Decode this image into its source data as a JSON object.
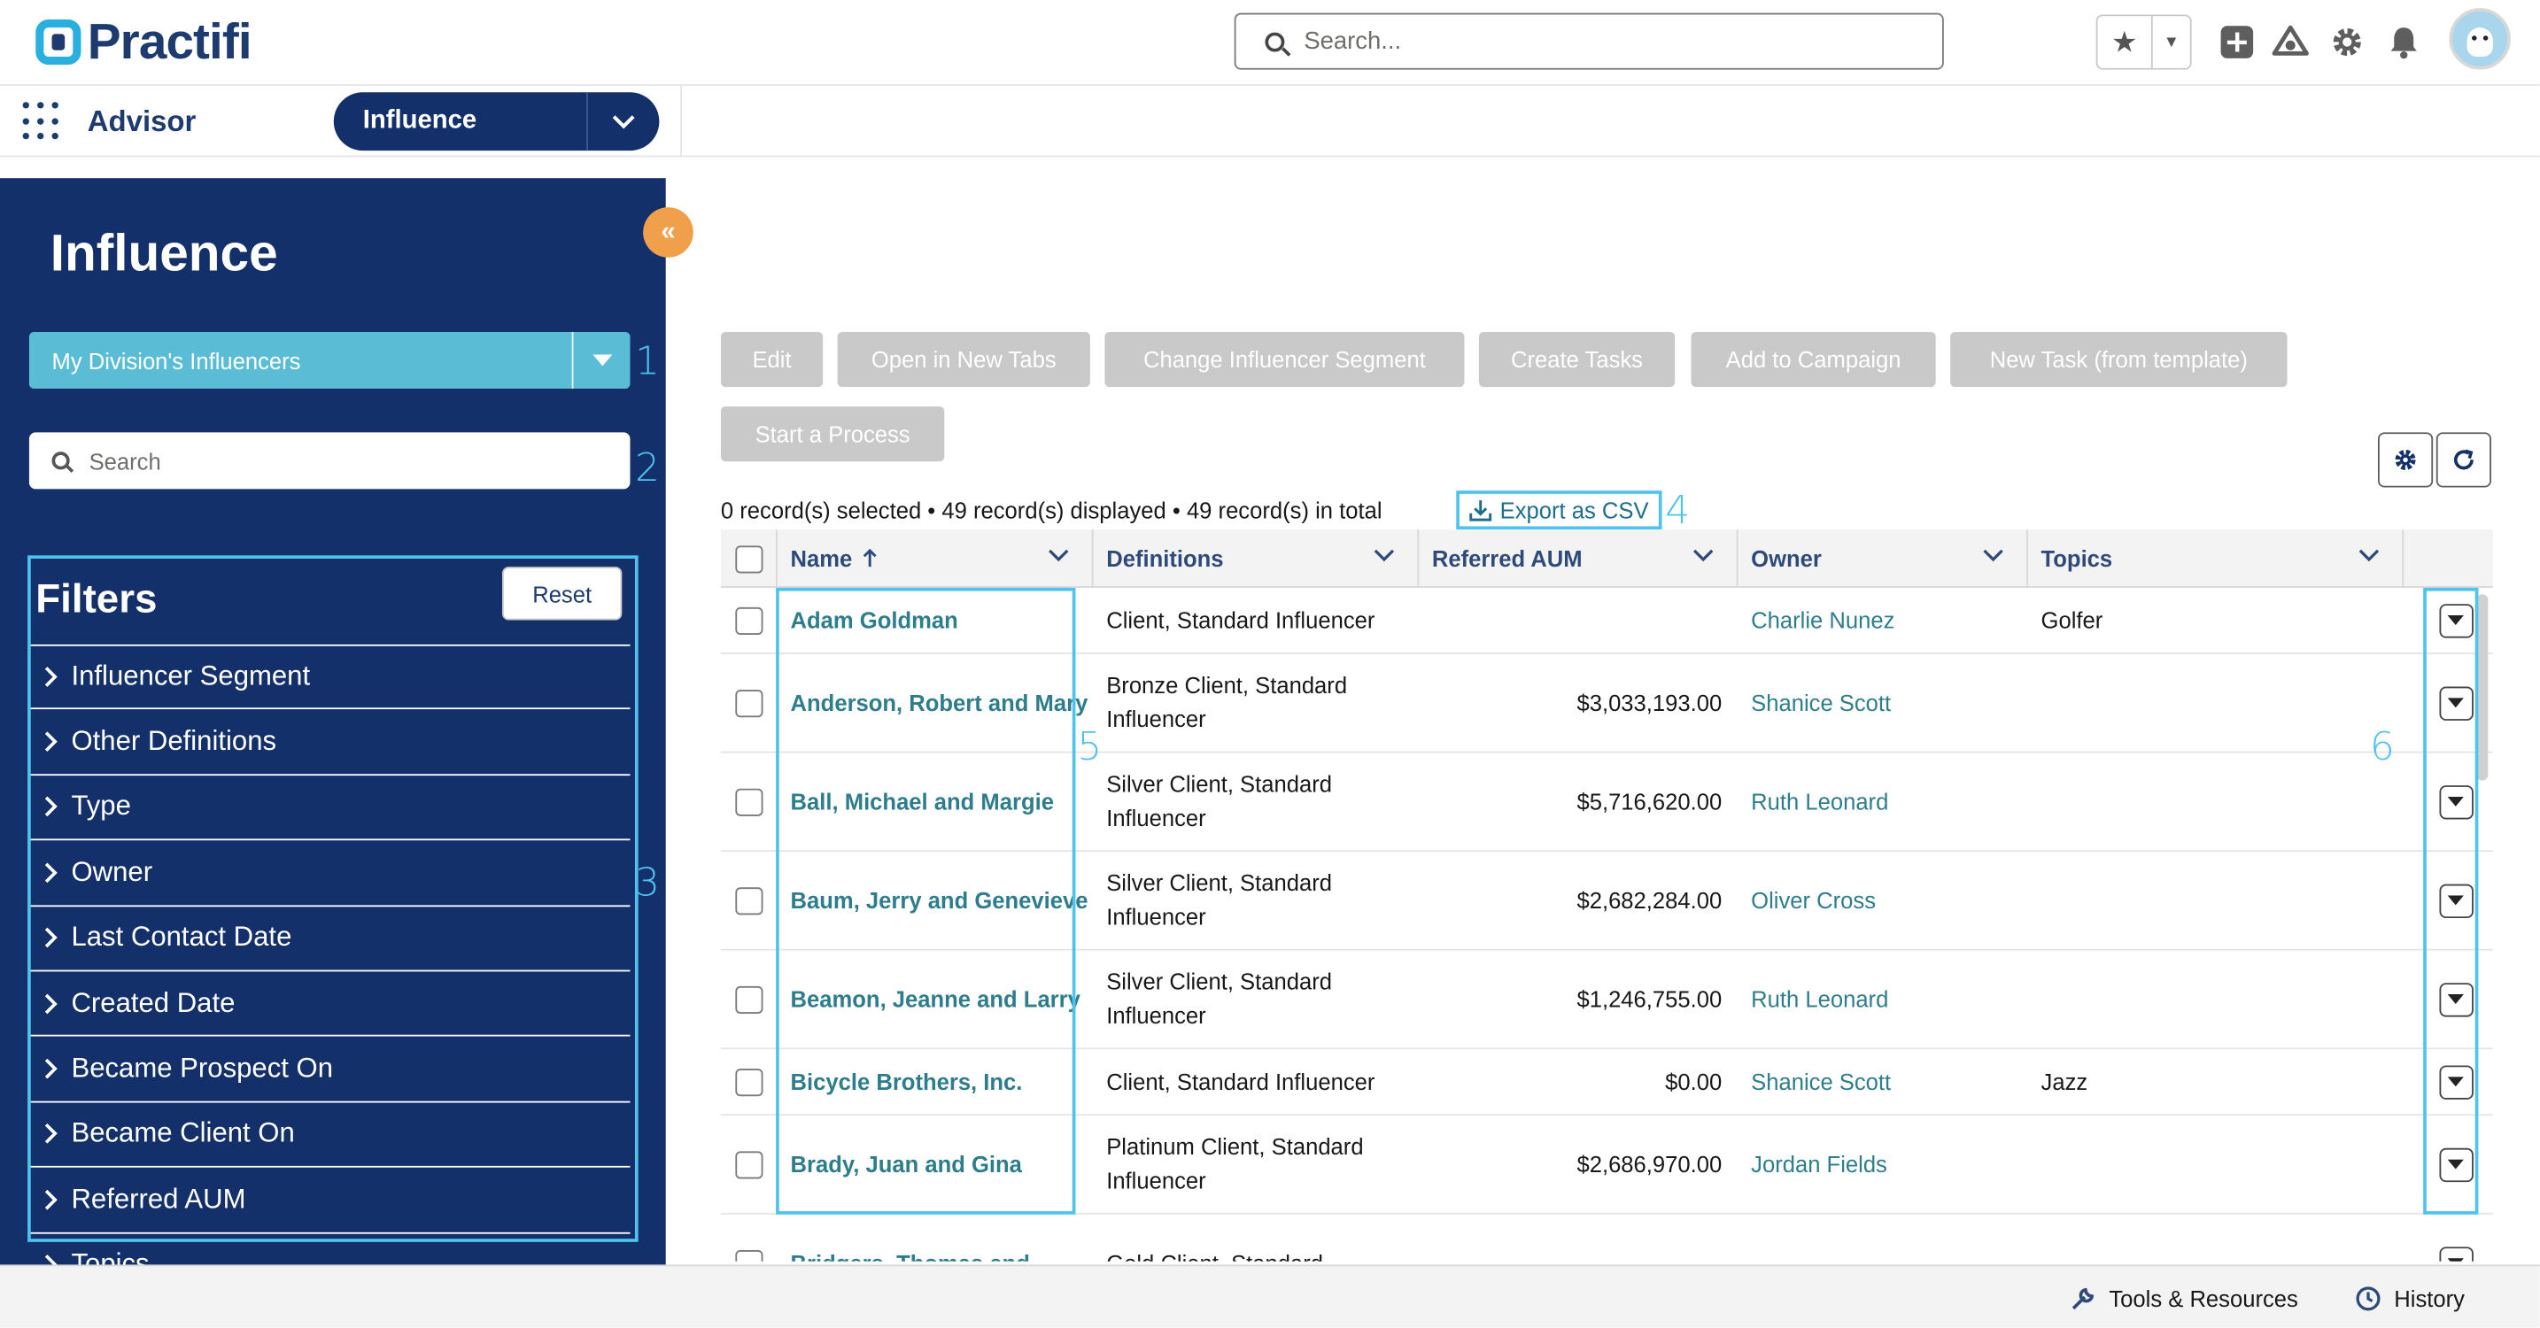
{
  "brand": {
    "name": "Practifi"
  },
  "header": {
    "search_placeholder": "Search...",
    "favorites_icon": "star-icon"
  },
  "appbar": {
    "app_name": "Advisor",
    "tab_label": "Influence"
  },
  "sidebar": {
    "title": "Influence",
    "list_view": "My Division's Influencers",
    "search_placeholder": "Search",
    "filters_title": "Filters",
    "reset_label": "Reset",
    "filters": [
      "Influencer Segment",
      "Other Definitions",
      "Type",
      "Owner",
      "Last Contact Date",
      "Created Date",
      "Became Prospect On",
      "Became Client On",
      "Referred AUM",
      "Topics"
    ]
  },
  "actions": {
    "buttons": [
      "Edit",
      "Open in New Tabs",
      "Change Influencer Segment",
      "Create Tasks",
      "Add to Campaign",
      "New Task (from template)",
      "Start a Process"
    ]
  },
  "summary": {
    "selected": "0 record(s) selected",
    "displayed": "49 record(s) displayed",
    "total": "49 record(s) in total",
    "export_label": "Export as CSV"
  },
  "table": {
    "columns": [
      "Name",
      "Definitions",
      "Referred AUM",
      "Owner",
      "Topics"
    ],
    "rows": [
      {
        "name": "Adam Goldman",
        "definitions": "Client, Standard Influencer",
        "aum": "",
        "owner": "Charlie Nunez",
        "topics": "Golfer"
      },
      {
        "name": "Anderson, Robert and Mary",
        "definitions": "Bronze Client, Standard Influencer",
        "aum": "$3,033,193.00",
        "owner": "Shanice Scott",
        "topics": ""
      },
      {
        "name": "Ball, Michael and Margie",
        "definitions": "Silver Client, Standard Influencer",
        "aum": "$5,716,620.00",
        "owner": "Ruth Leonard",
        "topics": ""
      },
      {
        "name": "Baum, Jerry and Genevieve",
        "definitions": "Silver Client, Standard Influencer",
        "aum": "$2,682,284.00",
        "owner": "Oliver Cross",
        "topics": ""
      },
      {
        "name": "Beamon, Jeanne and Larry",
        "definitions": "Silver Client, Standard Influencer",
        "aum": "$1,246,755.00",
        "owner": "Ruth Leonard",
        "topics": ""
      },
      {
        "name": "Bicycle Brothers, Inc.",
        "definitions": "Client, Standard Influencer",
        "aum": "$0.00",
        "owner": "Shanice Scott",
        "topics": "Jazz"
      },
      {
        "name": "Brady, Juan and Gina",
        "definitions": "Platinum Client, Standard Influencer",
        "aum": "$2,686,970.00",
        "owner": "Jordan Fields",
        "topics": ""
      },
      {
        "name": "Bridgers, Thomas and",
        "definitions": "Gold Client, Standard",
        "aum": "",
        "owner": "",
        "topics": ""
      }
    ]
  },
  "annotations": [
    "1",
    "2",
    "3",
    "4",
    "5",
    "6"
  ],
  "utility_bar": {
    "tools_label": "Tools & Resources",
    "history_label": "History"
  },
  "colors": {
    "navy": "#14306a",
    "teal_link": "#2e7d8c",
    "annotation": "#4ec3ee",
    "orange": "#f0a04b",
    "disabled_button": "#c9c9c9"
  }
}
